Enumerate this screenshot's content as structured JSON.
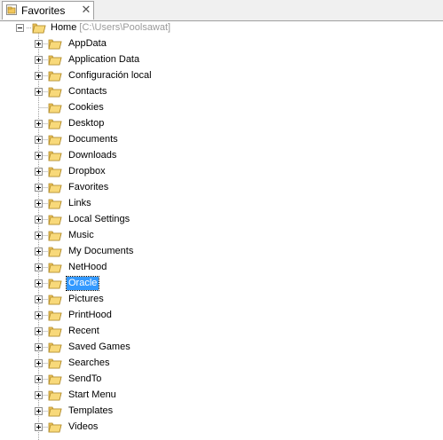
{
  "tab": {
    "label": "Favorites",
    "close_glyph": "✕",
    "icon": "favorites-folder-icon"
  },
  "tree": {
    "root": {
      "label": "Home",
      "path": "[C:\\Users\\Poolsawat]",
      "expanded": true
    },
    "items": [
      {
        "label": "AppData",
        "expandable": true,
        "selected": false
      },
      {
        "label": "Application Data",
        "expandable": true,
        "selected": false
      },
      {
        "label": "Configuración local",
        "expandable": true,
        "selected": false
      },
      {
        "label": "Contacts",
        "expandable": true,
        "selected": false
      },
      {
        "label": "Cookies",
        "expandable": false,
        "selected": false
      },
      {
        "label": "Desktop",
        "expandable": true,
        "selected": false
      },
      {
        "label": "Documents",
        "expandable": true,
        "selected": false
      },
      {
        "label": "Downloads",
        "expandable": true,
        "selected": false
      },
      {
        "label": "Dropbox",
        "expandable": true,
        "selected": false
      },
      {
        "label": "Favorites",
        "expandable": true,
        "selected": false
      },
      {
        "label": "Links",
        "expandable": true,
        "selected": false
      },
      {
        "label": "Local Settings",
        "expandable": true,
        "selected": false
      },
      {
        "label": "Music",
        "expandable": true,
        "selected": false
      },
      {
        "label": "My Documents",
        "expandable": true,
        "selected": false
      },
      {
        "label": "NetHood",
        "expandable": true,
        "selected": false
      },
      {
        "label": "Oracle",
        "expandable": true,
        "selected": true
      },
      {
        "label": "Pictures",
        "expandable": true,
        "selected": false
      },
      {
        "label": "PrintHood",
        "expandable": true,
        "selected": false
      },
      {
        "label": "Recent",
        "expandable": true,
        "selected": false
      },
      {
        "label": "Saved Games",
        "expandable": true,
        "selected": false
      },
      {
        "label": "Searches",
        "expandable": true,
        "selected": false
      },
      {
        "label": "SendTo",
        "expandable": true,
        "selected": false
      },
      {
        "label": "Start Menu",
        "expandable": true,
        "selected": false
      },
      {
        "label": "Templates",
        "expandable": true,
        "selected": false
      },
      {
        "label": "Videos",
        "expandable": true,
        "selected": false
      }
    ]
  },
  "colors": {
    "selection": "#3399ff",
    "folder": "#f2c75c",
    "path_text": "#9a9a9a"
  }
}
